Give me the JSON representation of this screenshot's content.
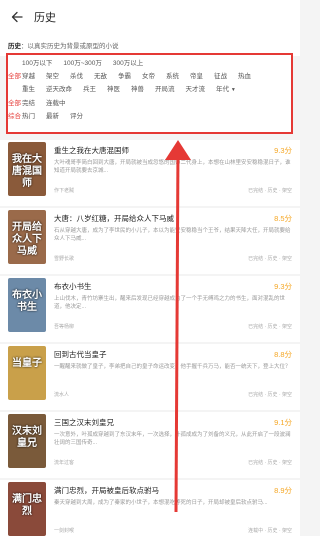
{
  "header": {
    "title": "历史"
  },
  "description": {
    "label": "历史",
    "text": "以真实历史为背景或原型的小说"
  },
  "filters": {
    "row1": {
      "label": "",
      "items": [
        "100万以下",
        "100万~300万",
        "300万以上"
      ]
    },
    "row2": {
      "label": "全部",
      "items": [
        "穿越",
        "架空",
        "杀伐",
        "无敌",
        "争霸",
        "女帝",
        "系统",
        "帝皇",
        "征战",
        "热血"
      ]
    },
    "row3": {
      "label": "",
      "items": [
        "重生",
        "逆天改命",
        "兵王",
        "神医",
        "神兽",
        "开局流",
        "天才流",
        "年代"
      ]
    },
    "row4": {
      "label": "全部",
      "items": [
        "完结",
        "连载中"
      ]
    },
    "row5": {
      "label": "综合",
      "items": [
        "热门",
        "最新",
        "评分"
      ]
    }
  },
  "books": [
    {
      "title": "重生之我在大唐混国师",
      "desc": "大叶魂哥李简白回到大唐，开局就被当成忽悠的国师二代身上，本想在山林里安安稳稳混日子，谁知道开局就要去京城...",
      "author": "作下老贼",
      "status": "已完结 · 历史 · 架空",
      "score": "9.3分",
      "cover_text": "我在大唐混国师",
      "cover_color": "#8a5a3a"
    },
    {
      "title": "大唐：八岁红糖，开局给众人下马威",
      "desc": "石从穿越大唐，成为了李世民的小儿子，本以为能安安稳稳当个王爷，结果天降大任，开局就要给众人下马威...",
      "author": "雪野长歌",
      "status": "已完结 · 历史 · 架空",
      "score": "8.5分",
      "cover_text": "开局给众人下马威",
      "cover_color": "#9a6a4a"
    },
    {
      "title": "布衣小书生",
      "desc": "上山伐木，青竹坊寨生出，醒来后发现已经穿越成为了一个手无缚鸡之力的书生，面对混乱的世道，他决定...",
      "author": "吾等杨柳",
      "status": "已完结 · 历史 · 架空",
      "score": "9.3分",
      "cover_text": "布衣小书生",
      "cover_color": "#6c8aa8"
    },
    {
      "title": "回到古代当皇子",
      "desc": "一醒醒来就做了皇子，李弟把自己的皇子命运改变，他手握千兵万马，能否一统天下，登上大位？",
      "author": "流水人",
      "status": "已完结 · 历史 · 架空",
      "score": "8.8分",
      "cover_text": "当皇子",
      "cover_color": "#c9a04a"
    },
    {
      "title": "三国之汉末刘皇兄",
      "desc": "一次意外，叶孤成穿越到了东汉末年，一次选择，叶孤成成为了刘备的义兄，从此开启了一段波澜壮阔的三国传奇...",
      "author": "流年过客",
      "status": "已完结 · 历史 · 架空",
      "score": "9.1分",
      "cover_text": "汉末刘皇兄",
      "cover_color": "#7a5a3a"
    },
    {
      "title": "满门忠烈，开局被皇后软点驸马",
      "desc": "秦天穿越到大周，成为了秦家的小世子，本想混吃等死的日子，开局却被皇后软点驸马...",
      "author": "一剑封喉",
      "status": "连载中 · 历史 · 架空",
      "score": "8.9分",
      "cover_text": "满门忠烈",
      "cover_color": "#8a4a3a"
    }
  ],
  "colors": {
    "accent": "#e53935",
    "score": "#f5a623"
  }
}
